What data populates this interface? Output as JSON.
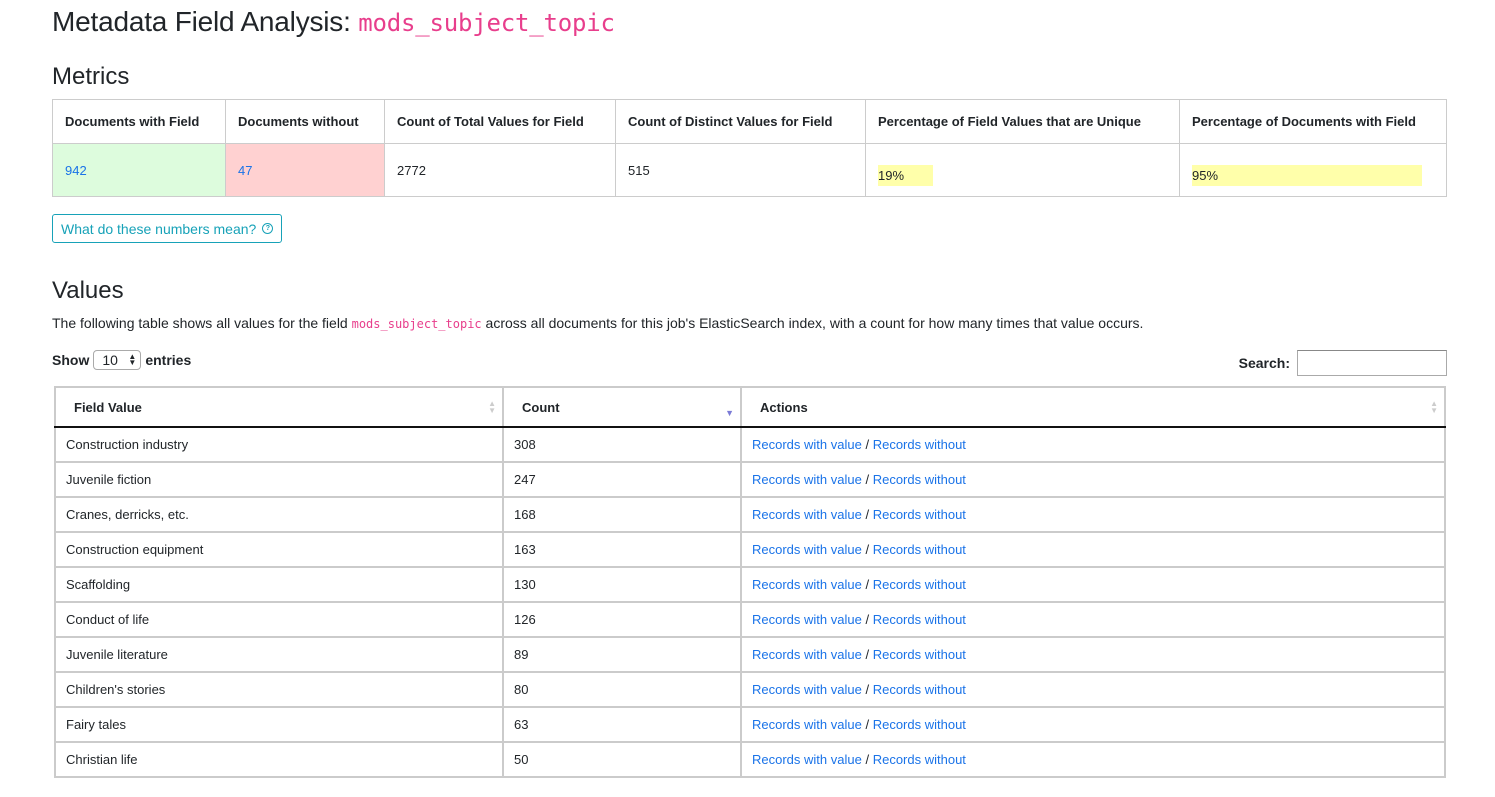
{
  "page": {
    "title_prefix": "Metadata Field Analysis:",
    "field_name": "mods_subject_topic"
  },
  "metrics": {
    "heading": "Metrics",
    "headers": [
      "Documents with Field",
      "Documents without",
      "Count of Total Values for Field",
      "Count of Distinct Values for Field",
      "Percentage of Field Values that are Unique",
      "Percentage of Documents with Field"
    ],
    "documents_with_field": "942",
    "documents_without": "47",
    "total_values": "2772",
    "distinct_values": "515",
    "pct_unique": "19%",
    "pct_unique_value": 19,
    "pct_documents": "95%",
    "pct_documents_value": 95,
    "colors": {
      "with_bg": "#ddfcdd",
      "without_bg": "#ffd1d1",
      "pct_bar": "#ffffaa"
    }
  },
  "help_button": {
    "label": "What do these numbers mean?",
    "icon": "question-circle-icon"
  },
  "values": {
    "heading": "Values",
    "desc_before": "The following table shows all values for the field",
    "desc_field": "mods_subject_topic",
    "desc_after": "across all documents for this job's ElasticSearch index, with a count for how many times that value occurs.",
    "show_label": "Show",
    "entries_label": "entries",
    "page_length": "10",
    "search_label": "Search:",
    "search_value": "",
    "columns": [
      "Field Value",
      "Count",
      "Actions"
    ],
    "sort": {
      "column": "Count",
      "direction": "desc"
    },
    "action_with": "Records with value",
    "action_sep": "/",
    "action_without": "Records without",
    "rows": [
      {
        "value": "Construction industry",
        "count": "308"
      },
      {
        "value": "Juvenile fiction",
        "count": "247"
      },
      {
        "value": "Cranes, derricks, etc.",
        "count": "168"
      },
      {
        "value": "Construction equipment",
        "count": "163"
      },
      {
        "value": "Scaffolding",
        "count": "130"
      },
      {
        "value": "Conduct of life",
        "count": "126"
      },
      {
        "value": "Juvenile literature",
        "count": "89"
      },
      {
        "value": "Children's stories",
        "count": "80"
      },
      {
        "value": "Fairy tales",
        "count": "63"
      },
      {
        "value": "Christian life",
        "count": "50"
      }
    ]
  }
}
